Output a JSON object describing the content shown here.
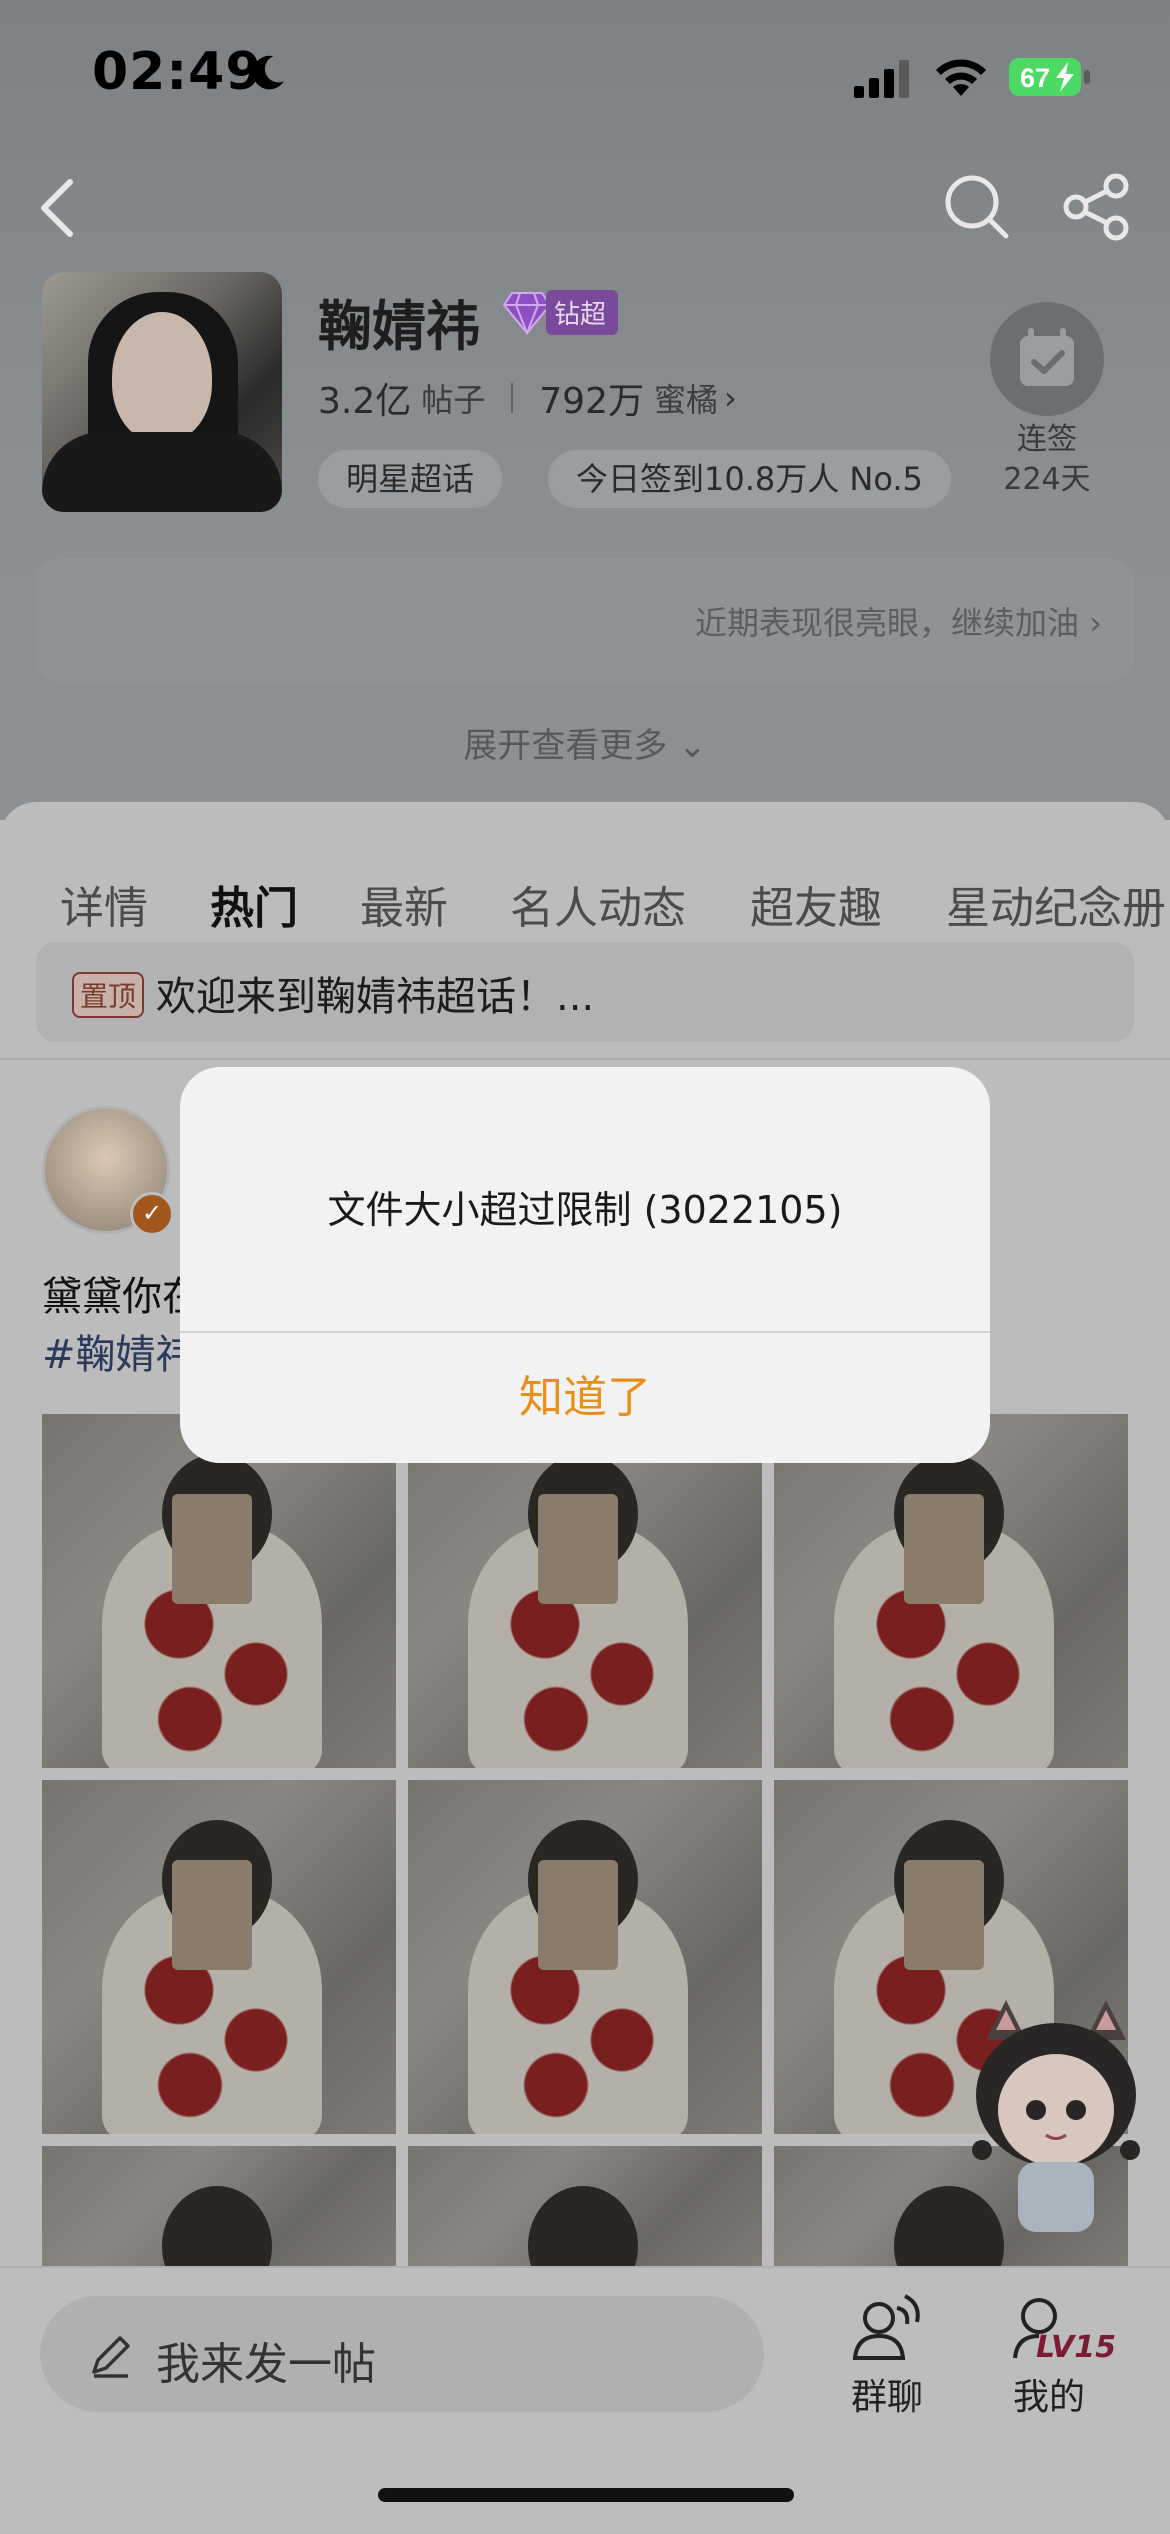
{
  "status_bar": {
    "time": "02:49",
    "battery": "67"
  },
  "topic": {
    "name": "鞠婧祎",
    "badge": "钻超",
    "posts_count": "3.2亿",
    "posts_unit": "帖子",
    "fans_count": "792万",
    "fans_unit": "蜜橘",
    "tag1": "明星超话",
    "tag2": "今日签到10.8万人 No.5",
    "checkin_label": "连签",
    "checkin_days": "224天",
    "performance_text": "近期表现很亮眼，继续加油",
    "expand_text": "展开查看更多"
  },
  "tabs": [
    "详情",
    "热门",
    "最新",
    "名人动态",
    "超友趣",
    "星动纪念册"
  ],
  "pinned": {
    "tag": "置顶",
    "text": "欢迎来到鞠婧祎超话！..."
  },
  "post": {
    "line1": "黛黛你在",
    "line2": "#鞠婧祎"
  },
  "bottom_bar": {
    "compose_placeholder": "我来发一帖",
    "group_chat_label": "群聊",
    "mine_label": "我的",
    "level": "LV15"
  },
  "dialog": {
    "message": "文件大小超过限制 (3022105)",
    "confirm_label": "知道了"
  },
  "colors": {
    "accent": "#e88f1a",
    "badge_purple": "#7a4a9a",
    "battery_green": "#4cd964"
  }
}
